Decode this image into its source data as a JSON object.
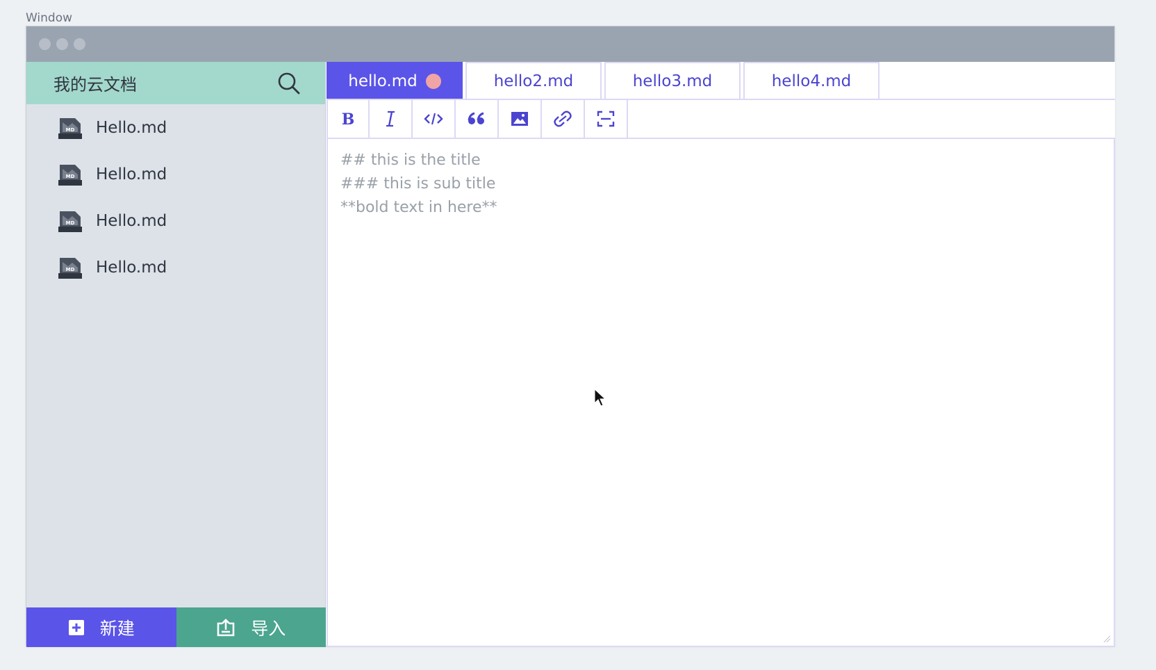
{
  "window_caption": "Window",
  "sidebar": {
    "title": "我的云文档",
    "search_icon": "search-icon",
    "files": [
      {
        "name": "Hello.md",
        "icon": "markdown-file-icon"
      },
      {
        "name": "Hello.md",
        "icon": "markdown-file-icon"
      },
      {
        "name": "Hello.md",
        "icon": "markdown-file-icon"
      },
      {
        "name": "Hello.md",
        "icon": "markdown-file-icon"
      }
    ],
    "footer": {
      "new_label": "新建",
      "import_label": "导入"
    }
  },
  "tabs": [
    {
      "label": "hello.md",
      "active": true,
      "unsaved": true
    },
    {
      "label": "hello2.md",
      "active": false,
      "unsaved": false
    },
    {
      "label": "hello3.md",
      "active": false,
      "unsaved": false
    },
    {
      "label": "hello4.md",
      "active": false,
      "unsaved": false
    }
  ],
  "toolbar": [
    {
      "name": "bold",
      "icon": "bold-icon"
    },
    {
      "name": "italic",
      "icon": "italic-icon"
    },
    {
      "name": "code",
      "icon": "code-icon"
    },
    {
      "name": "quote",
      "icon": "quote-icon"
    },
    {
      "name": "image",
      "icon": "image-icon"
    },
    {
      "name": "link",
      "icon": "link-icon"
    },
    {
      "name": "preview",
      "icon": "fullscreen-icon"
    }
  ],
  "editor": {
    "lines": [
      "## this is the title",
      "### this is sub title",
      "**bold text in here**"
    ]
  },
  "colors": {
    "accent": "#5b54e8",
    "teal": "#4ba58f",
    "sidebar_header": "#a3d8cc",
    "sidebar_bg": "#dde2e9",
    "titlebar": "#9aa4b1",
    "unsaved_dot": "#f0a5a5"
  }
}
